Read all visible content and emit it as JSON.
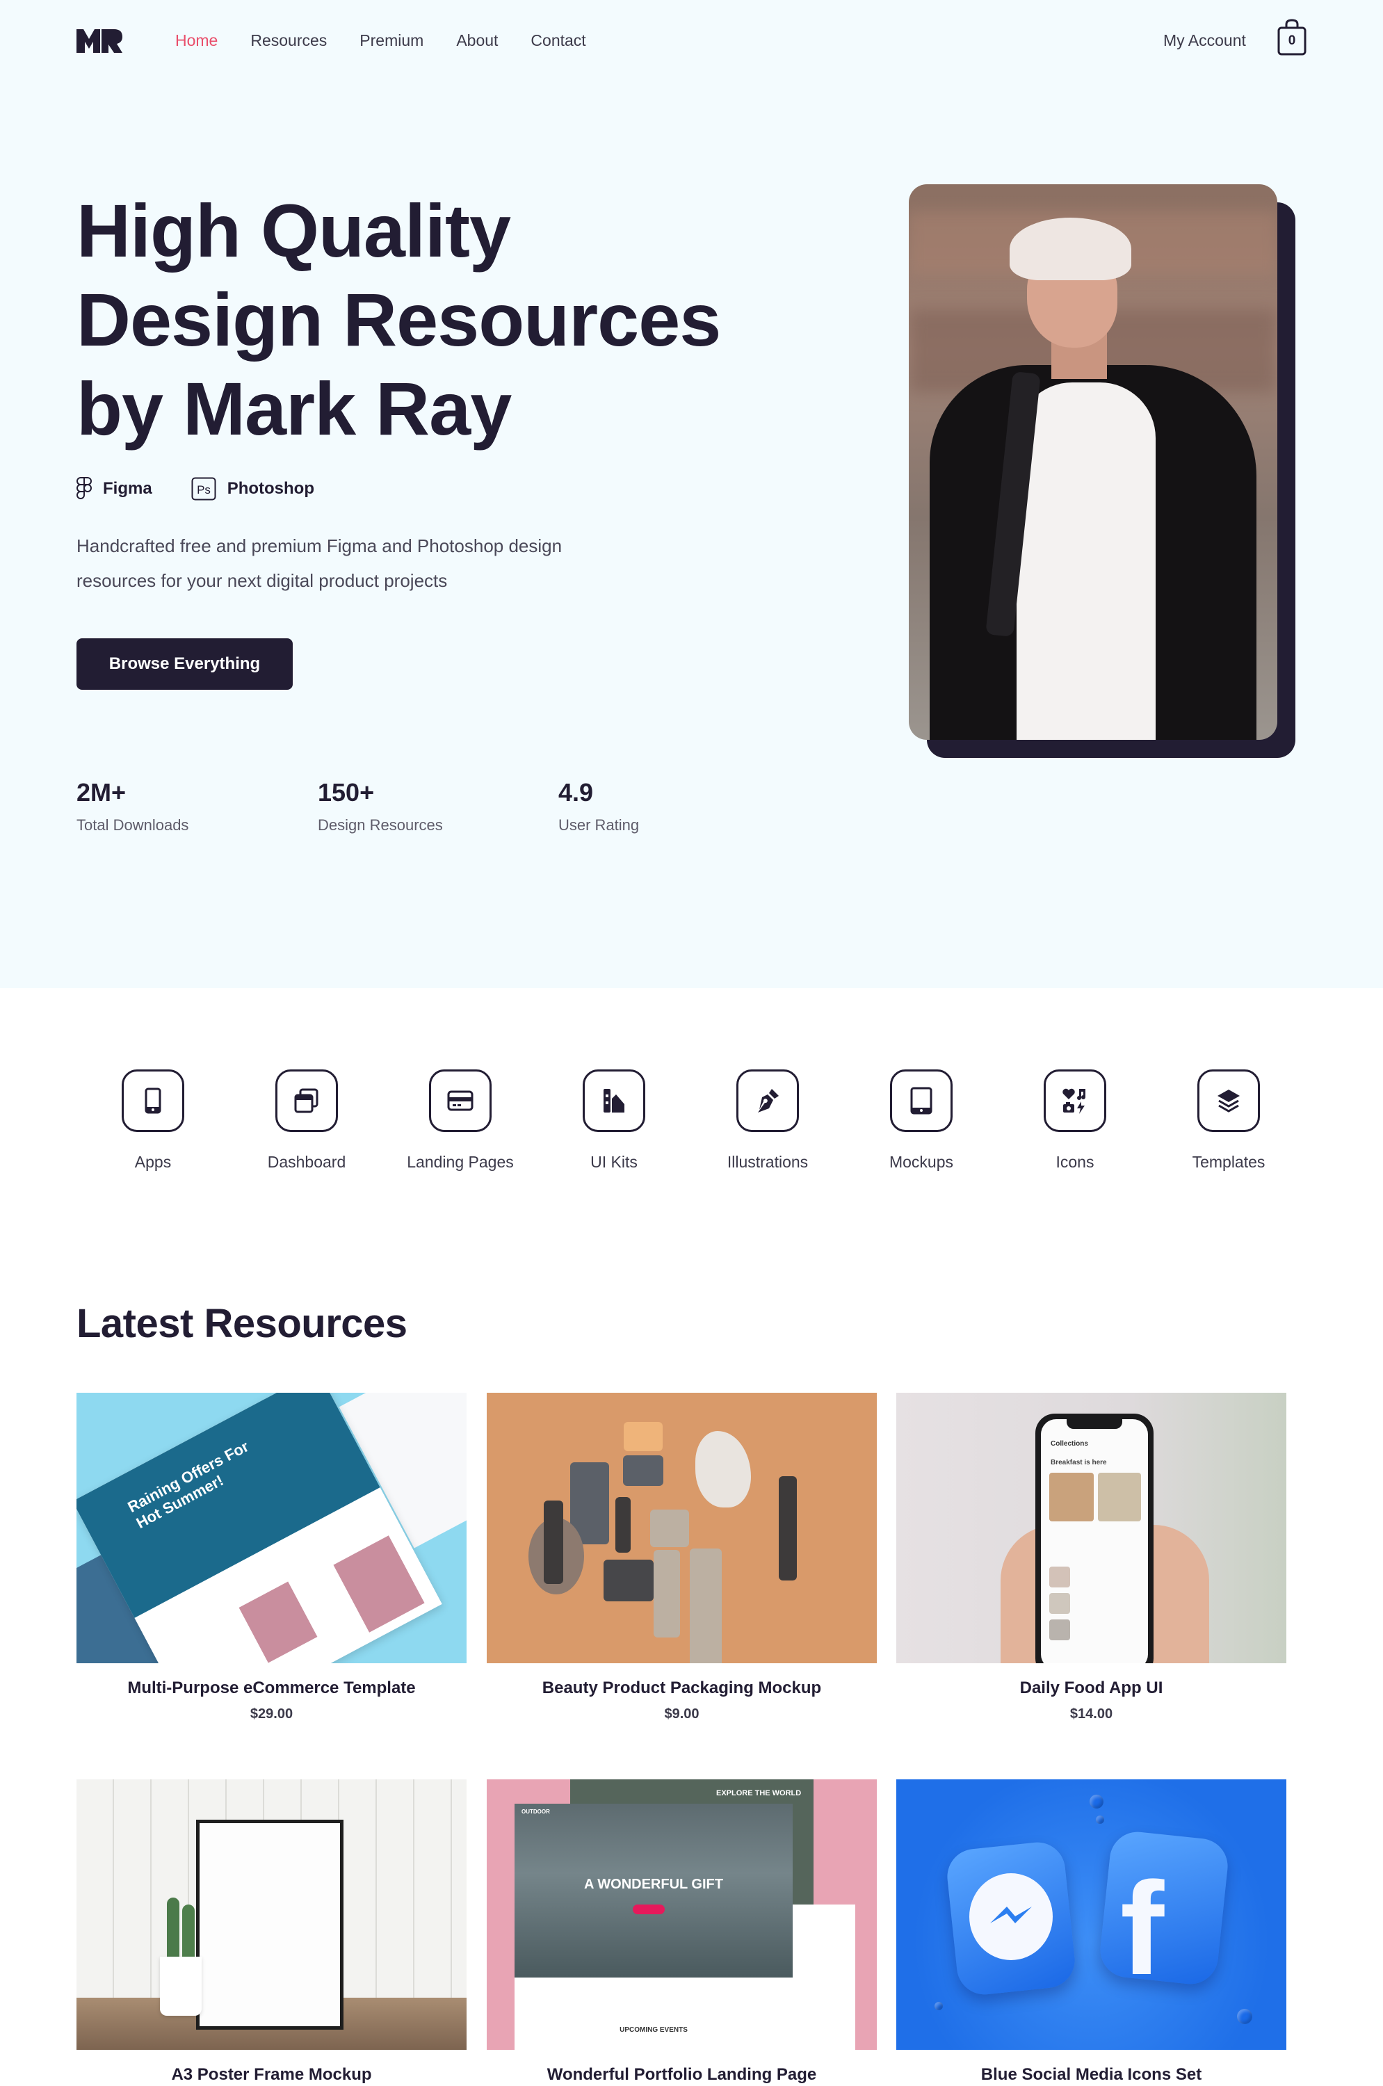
{
  "header": {
    "logo": "MR",
    "nav": [
      {
        "label": "Home",
        "active": true
      },
      {
        "label": "Resources",
        "active": false
      },
      {
        "label": "Premium",
        "active": false
      },
      {
        "label": "About",
        "active": false
      },
      {
        "label": "Contact",
        "active": false
      }
    ],
    "account_label": "My Account",
    "cart_count": "0",
    "accent_color": "#e94e6b"
  },
  "hero": {
    "title_lines": [
      "High Quality",
      "Design Resources",
      "by Mark Ray"
    ],
    "tools": [
      {
        "icon": "figma-icon",
        "label": "Figma"
      },
      {
        "icon": "photoshop-icon",
        "label": "Photoshop",
        "icon_text": "Ps"
      }
    ],
    "description_lines": [
      "Handcrafted free and premium Figma and Photoshop design",
      "resources for your next digital product projects"
    ],
    "cta_label": "Browse Everything",
    "stats": [
      {
        "value": "2M+",
        "label": "Total Downloads"
      },
      {
        "value": "150+",
        "label": "Design Resources"
      },
      {
        "value": "4.9",
        "label": "User Rating"
      }
    ],
    "image_alt": "Portrait of Mark Ray"
  },
  "categories": [
    {
      "icon": "smartphone-icon",
      "label": "Apps"
    },
    {
      "icon": "windows-icon",
      "label": "Dashboard"
    },
    {
      "icon": "browser-card-icon",
      "label": "Landing Pages"
    },
    {
      "icon": "swatches-icon",
      "label": "UI Kits"
    },
    {
      "icon": "pen-nib-icon",
      "label": "Illustrations"
    },
    {
      "icon": "tablet-icon",
      "label": "Mockups"
    },
    {
      "icon": "icon-set-icon",
      "label": "Icons"
    },
    {
      "icon": "layers-icon",
      "label": "Templates"
    }
  ],
  "latest": {
    "title": "Latest Resources",
    "cards": [
      {
        "title": "Multi-Purpose eCommerce Template",
        "price": "$29.00",
        "image_text": "Raining Offers For Hot Summer!"
      },
      {
        "title": "Beauty Product Packaging Mockup",
        "price": "$9.00"
      },
      {
        "title": "Daily Food App UI",
        "price": "$14.00",
        "image_text": "Collections",
        "image_text2": "Breakfast is here"
      },
      {
        "title": "A3 Poster Frame Mockup",
        "price": ""
      },
      {
        "title": "Wonderful Portfolio Landing Page",
        "price": "",
        "image_text": "A WONDERFUL GIFT",
        "image_text2": "EXPLORE THE WORLD",
        "image_text3": "UPCOMING EVENTS",
        "image_text4": "OUTDOOR"
      },
      {
        "title": "Blue Social Media Icons Set",
        "price": "",
        "image_text": "f"
      }
    ]
  }
}
